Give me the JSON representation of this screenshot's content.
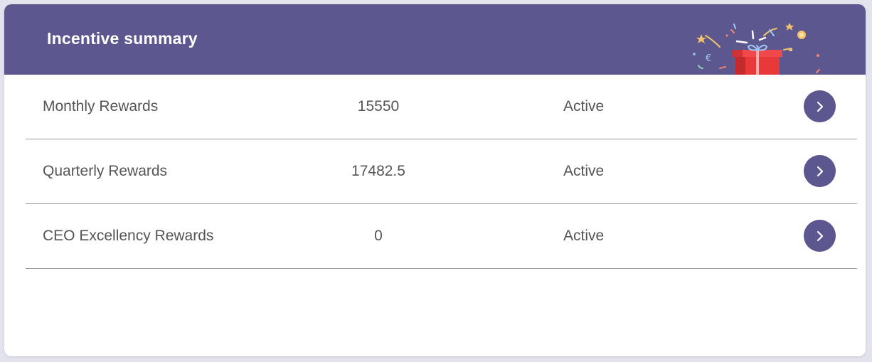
{
  "header": {
    "title": "Incentive summary",
    "illustration_icon": "gift-box-confetti-icon",
    "background_color": "#5c578f"
  },
  "rows": [
    {
      "name": "Monthly Rewards",
      "amount": "15550",
      "status": "Active",
      "action_icon": "chevron-right-icon"
    },
    {
      "name": "Quarterly Rewards",
      "amount": "17482.5",
      "status": "Active",
      "action_icon": "chevron-right-icon"
    },
    {
      "name": "CEO Excellency Rewards",
      "amount": "0",
      "status": "Active",
      "action_icon": "chevron-right-icon"
    }
  ],
  "colors": {
    "accent": "#5c578f",
    "text": "#555555",
    "divider": "#9a9a9a"
  }
}
